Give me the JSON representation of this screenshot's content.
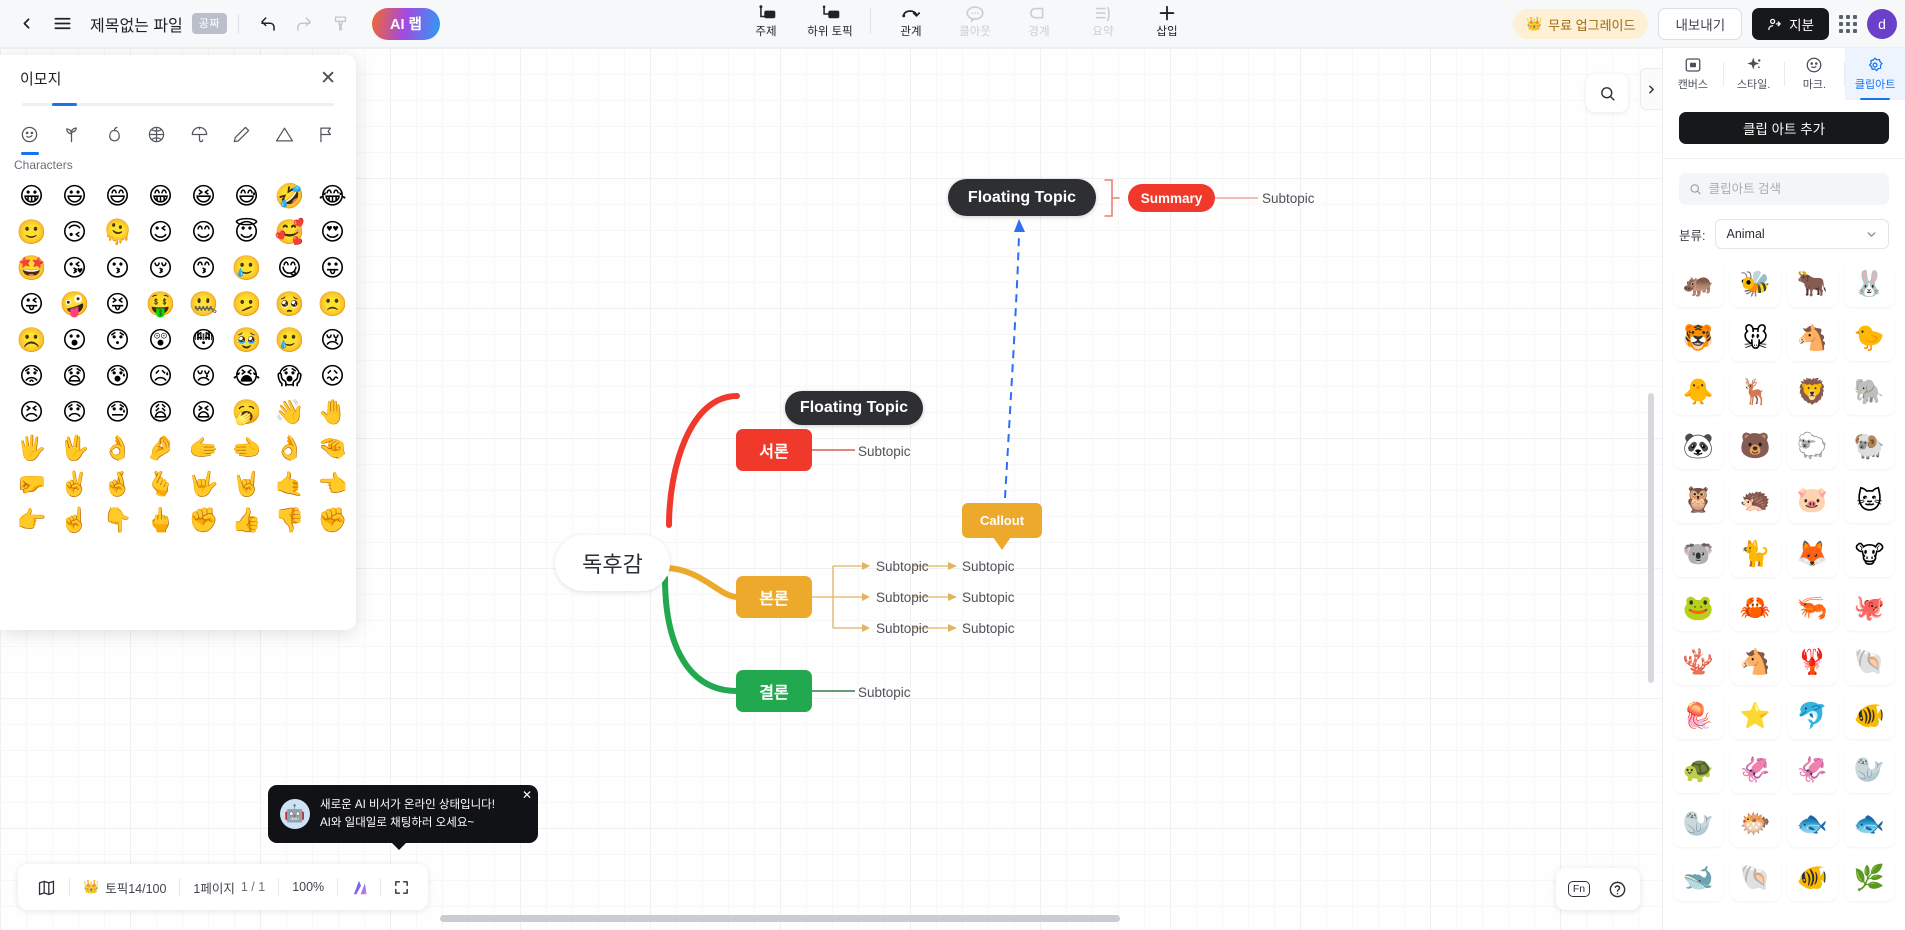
{
  "topbar": {
    "back_icon": "chevron-left-icon",
    "menu_icon": "hamburger-menu-icon",
    "doc_title": "제목없는 파일",
    "public_badge": "공짜",
    "undo_icon": "undo-icon",
    "redo_icon": "redo-icon",
    "format_painter_icon": "format-painter-icon",
    "ai_lab": "AI 랩",
    "tools": [
      {
        "label": "주제",
        "icon": "topic-icon",
        "disabled": false
      },
      {
        "label": "하위 토픽",
        "icon": "subtopic-icon",
        "disabled": false
      },
      {
        "label": "관계",
        "icon": "relationship-icon",
        "disabled": false
      },
      {
        "label": "콜아웃",
        "icon": "callout-icon",
        "disabled": true
      },
      {
        "label": "경계",
        "icon": "boundary-icon",
        "disabled": true
      },
      {
        "label": "요약",
        "icon": "summary-icon",
        "disabled": true
      },
      {
        "label": "삽입",
        "icon": "insert-plus-icon",
        "disabled": false
      }
    ],
    "upgrade": "무료 업그레이드",
    "upgrade_icon": "crown-icon",
    "export": "내보내기",
    "share": "지분",
    "share_icon": "person-share-icon",
    "apps_icon": "apps-grid-icon",
    "avatar_initial": "d"
  },
  "emoji_panel": {
    "title": "이모지",
    "close_icon": "close-icon",
    "section_label": "Characters",
    "categories": [
      {
        "name": "smiley-face-icon",
        "active": true
      },
      {
        "name": "plant-sprout-icon",
        "active": false
      },
      {
        "name": "apple-food-icon",
        "active": false
      },
      {
        "name": "basketball-activity-icon",
        "active": false
      },
      {
        "name": "umbrella-travel-icon",
        "active": false
      },
      {
        "name": "pencil-object-icon",
        "active": false
      },
      {
        "name": "warning-triangle-icon",
        "active": false
      },
      {
        "name": "flag-icon",
        "active": false
      }
    ],
    "emojis": [
      "😀",
      "😃",
      "😄",
      "😁",
      "😆",
      "😅",
      "🤣",
      "😂",
      "🙂",
      "🙃",
      "🫠",
      "😉",
      "😊",
      "😇",
      "🥰",
      "😍",
      "🤩",
      "😘",
      "😗",
      "😚",
      "😙",
      "🥲",
      "😋",
      "😛",
      "😜",
      "🤪",
      "😝",
      "🤑",
      "🤐",
      "🫤",
      "🥺",
      "🙁",
      "☹️",
      "😮",
      "😯",
      "😲",
      "😳",
      "🥹",
      "🥲",
      "😢",
      "😟",
      "😧",
      "😰",
      "😥",
      "😢",
      "😭",
      "😱",
      "😖",
      "😣",
      "😞",
      "😓",
      "😩",
      "😫",
      "🥱",
      "👋",
      "🤚",
      "🖐️",
      "🖖",
      "👌",
      "🤌",
      "🫱",
      "🫲",
      "👌",
      "🤏",
      "🤛",
      "✌️",
      "🤞",
      "🫰",
      "🤟",
      "🤘",
      "🤙",
      "👈",
      "👉",
      "☝️",
      "👇",
      "🖕",
      "✊",
      "👍",
      "👎",
      "✊"
    ]
  },
  "canvas": {
    "search_icon": "search-icon",
    "collapse_icon": "chevron-right-icon",
    "nodes": {
      "central": "독후감",
      "floating_topic_main": "Floating Topic",
      "floating_topic_inner": "Floating Topic",
      "summary": "Summary",
      "summary_subtopic": "Subtopic",
      "callout": "Callout",
      "branch_intro": {
        "label": "서론",
        "color": "#f0392b",
        "subtopic": "Subtopic"
      },
      "branch_body": {
        "label": "본론",
        "color": "#eda92b",
        "subtopics": [
          {
            "l1": "Subtopic",
            "l2": "Subtopic"
          },
          {
            "l1": "Subtopic",
            "l2": "Subtopic"
          },
          {
            "l1": "Subtopic",
            "l2": "Subtopic"
          }
        ]
      },
      "branch_conclusion": {
        "label": "결론",
        "color": "#22a84f",
        "subtopic": "Subtopic"
      }
    }
  },
  "right_panel": {
    "tabs": [
      {
        "label": "캔버스",
        "icon": "canvas-icon",
        "active": false
      },
      {
        "label": "스타일.",
        "icon": "sparkle-style-icon",
        "active": false
      },
      {
        "label": "마크.",
        "icon": "marker-smiley-icon",
        "active": false
      },
      {
        "label": "클립아트",
        "icon": "clipart-flower-icon",
        "active": true
      }
    ],
    "add_clipart_button": "클립 아트 추가",
    "search_placeholder": "클립아트 검색",
    "search_icon": "search-icon",
    "category_label": "분류:",
    "category_value": "Animal",
    "chevron_icon": "chevron-down-icon",
    "cliparts": [
      "🦛",
      "🐝",
      "🐂",
      "🐰",
      "🐯",
      "🐭",
      "🐴",
      "🐤",
      "🐥",
      "🦌",
      "🦁",
      "🐘",
      "🐼",
      "🐻",
      "🐑",
      "🐏",
      "🦉",
      "🦔",
      "🐷",
      "🐱",
      "🐨",
      "🐈",
      "🦊",
      "🐮",
      "🐸",
      "🦀",
      "🦐",
      "🐙",
      "🪸",
      "🐴",
      "🦞",
      "🐚",
      "🪼",
      "⭐",
      "🐬",
      "🐠",
      "🐢",
      "🦑",
      "🦑",
      "🦭",
      "🦭",
      "🐡",
      "🐟",
      "🐟",
      "🐋",
      "🐚",
      "🐠",
      "🌿"
    ]
  },
  "statusbar": {
    "map_icon": "mini-map-icon",
    "crown_icon": "crown-icon",
    "topic_count": "토픽14/100",
    "page_label": "1페이지",
    "page_index": "1 / 1",
    "zoom": "100%",
    "theme_icon": "theme-colors-icon",
    "fullscreen_icon": "fullscreen-icon"
  },
  "helpers": {
    "fn_label": "Fn",
    "help_icon": "question-mark-icon"
  },
  "ai_toast": {
    "bot_icon": "robot-icon",
    "line1": "새로운 AI 비서가 온라인 상태입니다!",
    "line2": "AI와 일대일로 채팅하러 오세요~",
    "close_icon": "close-icon"
  }
}
